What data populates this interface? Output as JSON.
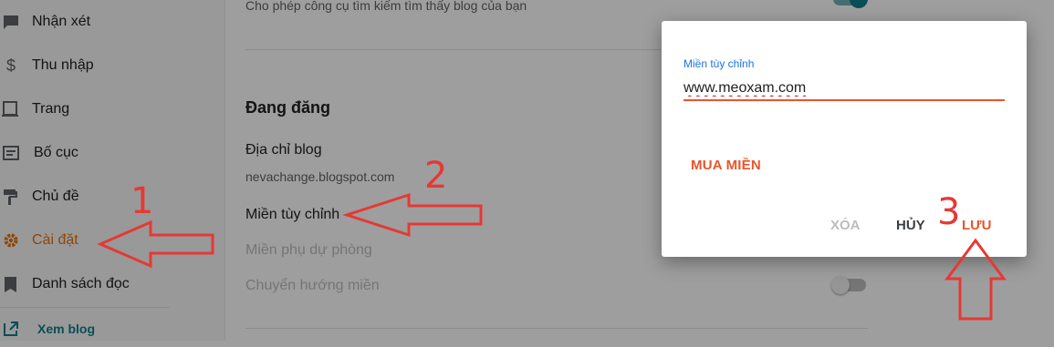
{
  "sidebar": {
    "items": [
      {
        "label": "Nhận xét",
        "icon": "comment-icon"
      },
      {
        "label": "Thu nhập",
        "icon": "dollar-icon"
      },
      {
        "label": "Trang",
        "icon": "page-icon"
      },
      {
        "label": "Bố cục",
        "icon": "layout-icon"
      },
      {
        "label": "Chủ đề",
        "icon": "theme-paint-roller-icon"
      },
      {
        "label": "Cài đặt",
        "icon": "gear-icon"
      },
      {
        "label": "Danh sách đọc",
        "icon": "bookmark-icon"
      }
    ],
    "active": "Cài đặt",
    "view_blog": {
      "label": "Xem blog",
      "icon": "external-link-icon"
    }
  },
  "settings": {
    "search_desc": "Cho phép công cụ tìm kiếm tìm thấy blog của bạn",
    "section_title": "Đang đăng",
    "blog_address_label": "Địa chỉ blog",
    "blog_address_value": "nevachange.blogspot.com",
    "custom_domain_label": "Miền tùy chỉnh",
    "backup_domain_label": "Miền phụ dự phòng",
    "redirect_domain_label": "Chuyển hướng miền"
  },
  "dialog": {
    "field_label": "Miền tùy chỉnh",
    "field_value": "www.meoxam.com",
    "buy_domain": "MUA MIỀN",
    "delete": "XÓA",
    "cancel": "HỦY",
    "save": "LƯU"
  },
  "annotations": {
    "step1": "1",
    "step2": "2",
    "step3": "3"
  },
  "colors": {
    "accent_orange": "#e8710a",
    "dialog_orange": "#e8552b",
    "teal": "#0f7e8a",
    "annotation_red": "#e53935"
  }
}
